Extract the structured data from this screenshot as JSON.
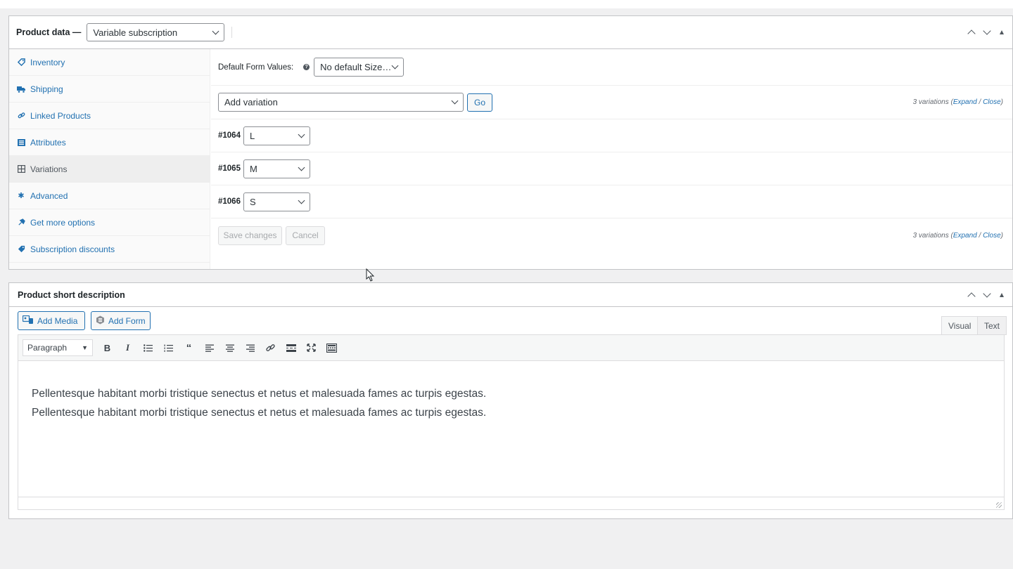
{
  "product_data": {
    "title": "Product data —",
    "type_select": "Variable subscription",
    "tabs": [
      {
        "label": "Inventory",
        "icon": "tag-icon"
      },
      {
        "label": "Shipping",
        "icon": "truck-icon"
      },
      {
        "label": "Linked Products",
        "icon": "link-icon"
      },
      {
        "label": "Attributes",
        "icon": "list-icon"
      },
      {
        "label": "Variations",
        "icon": "grid-icon",
        "active": true
      },
      {
        "label": "Advanced",
        "icon": "gear-icon"
      },
      {
        "label": "Get more options",
        "icon": "plugin-icon"
      },
      {
        "label": "Subscription discounts",
        "icon": "tag-icon"
      }
    ],
    "default_form_label": "Default Form Values:",
    "default_size_select": "No default Size…",
    "add_variation_select": "Add variation",
    "go_label": "Go",
    "variation_count": "3 variations",
    "expand_label": "Expand",
    "close_label": "Close",
    "variations": [
      {
        "id": "#1064",
        "size": "L"
      },
      {
        "id": "#1065",
        "size": "M"
      },
      {
        "id": "#1066",
        "size": "S"
      }
    ],
    "save_label": "Save changes",
    "cancel_label": "Cancel"
  },
  "short_description": {
    "title": "Product short description",
    "add_media_label": "Add Media",
    "add_form_label": "Add Form",
    "tab_visual": "Visual",
    "tab_text": "Text",
    "format_select": "Paragraph",
    "content": "Pellentesque habitant morbi tristique senectus et netus et malesuada fames ac turpis egestas. Pellentesque habitant morbi tristique senectus et netus et malesuada fames ac turpis egestas."
  },
  "colors": {
    "accent": "#2271b1",
    "border": "#c3c4c7",
    "background": "#f0f0f1"
  }
}
